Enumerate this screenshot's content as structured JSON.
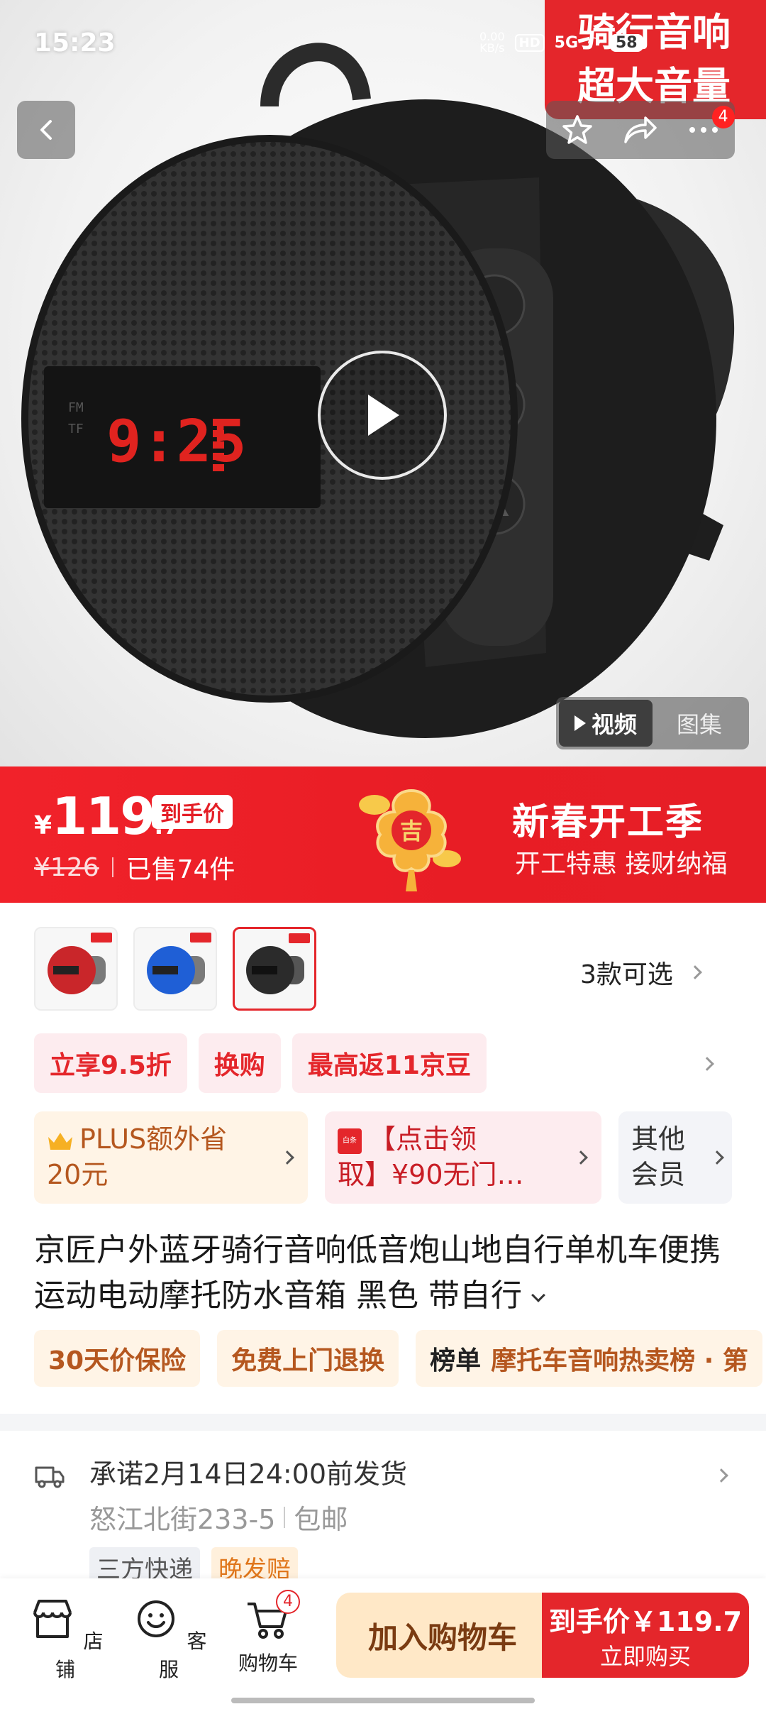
{
  "status_bar": {
    "time": "15:23",
    "net_speed": "0.00\nKB/s",
    "hd": "HD",
    "signal": "5G",
    "battery": "58"
  },
  "hero": {
    "promo_line1": "骑行音响",
    "promo_line2": "超大音量",
    "cart_count_badge": "4",
    "media_tabs": [
      "视频",
      "图集"
    ],
    "active_media_tab": "视频",
    "lcd_text": "9:25",
    "lcd_small1": "FM",
    "lcd_small2": "TF"
  },
  "price": {
    "currency": "¥",
    "integer": "119",
    "decimal": ".7",
    "tag": "到手价",
    "original": "¥126",
    "sold": "已售74件",
    "lucky_char": "吉",
    "banner_title": "新春开工季",
    "banner_sub": "开工特惠 接财纳福"
  },
  "variants": {
    "count_label": "3款可选",
    "items": [
      {
        "color": "#c9262a"
      },
      {
        "color": "#1f5fd6"
      },
      {
        "color": "#2b2b2b"
      }
    ],
    "selected_index": 2
  },
  "promotions": [
    "立享9.5折",
    "换购",
    "最高返11京豆"
  ],
  "cards": {
    "plus_line1": "PLUS额外省",
    "plus_line2": "20元",
    "coupon_line1": "【点击领",
    "coupon_line2": "取】¥90无门…",
    "coupon_icon_text": "白条",
    "other_line1": "其他",
    "other_line2": "会员"
  },
  "title": "京匠户外蓝牙骑行音响低音炮山地自行单机车便携运动电动摩托防水音箱 黑色 带自行",
  "services": {
    "price_protect": "30天价保险",
    "free_return": "免费上门退换",
    "rank_label": "榜单",
    "rank_text": "摩托车音响热卖榜 · 第"
  },
  "shipping": {
    "promise": "承诺2月14日24:00前发货",
    "address": "怒江北街233-5",
    "fee": "包邮",
    "tags": [
      "三方快递",
      "晚发赔"
    ]
  },
  "bottom_bar": {
    "store": "店铺",
    "service": "客服",
    "cart": "购物车",
    "cart_count": "4",
    "add_to_cart": "加入购物车",
    "buy_line1": "到手价￥119.7",
    "buy_line2": "立即购买"
  }
}
